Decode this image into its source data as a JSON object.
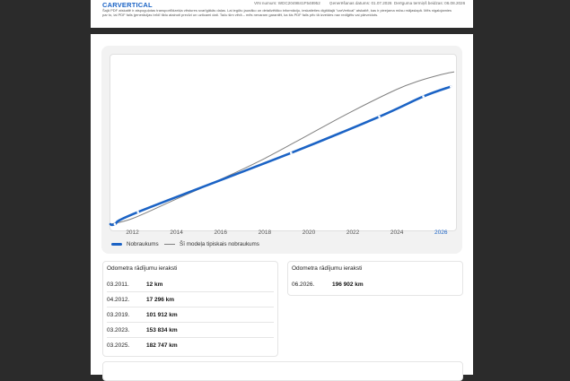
{
  "header": {
    "brand": "CARVERTICAL",
    "vin": "VIN numurs: WDC2049841F548952",
    "generated": "Ģenerēšanas datums: 01.07.2026",
    "expiry": "Derīguma termiņš beidzas: 06.08.2026",
    "disclaimer": "Šajā PDF atskaitē ir atspoguļotas transportlīdzekļa vēstures svarīgākās daļas. Lai iegūtu jaunāko un detalizētāko informāciju, ieskatieties digitālajā \"carVertical\" atskaitē, kas ir pieejama mūsu mājaslapā. Mēs nigalojamies par to, lai PDF fails ģenerācijas brīdī tiktu atainoti precīzi un uzticami dati. Taču šim vērā – mēs nevaram garantēt, ka šis PDF fails pēc tā izveides nav rediģēts vai pārveidots."
  },
  "chart_data": {
    "type": "line",
    "x_ticks": [
      "2012",
      "2014",
      "2016",
      "2018",
      "2020",
      "2022",
      "2024",
      "2026"
    ],
    "highlight_tick": "2026",
    "xlim": [
      2011.0,
      2026.6
    ],
    "ylim": [
      0,
      240000
    ],
    "grid": false,
    "legend_position": "bottom-left",
    "series": [
      {
        "name": "Nobraukums",
        "color": "#1b63c5",
        "x": [
          2011.0,
          2011.2,
          2012.25,
          2019.2,
          2023.2,
          2025.2,
          2026.45
        ],
        "y": [
          0,
          12,
          17296,
          101912,
          153834,
          182747,
          196902
        ],
        "markers": [
          2011.2,
          2012.25,
          2019.2,
          2023.2,
          2025.2,
          2026.45
        ]
      },
      {
        "name": "Šī modeļa tipiskais nobraukums",
        "color": "#808080",
        "x": [
          2011.0,
          2012,
          2014,
          2016,
          2018,
          2020,
          2022,
          2024,
          2025,
          2026,
          2026.6
        ],
        "y": [
          0,
          8000,
          36000,
          64000,
          94000,
          128000,
          162000,
          193000,
          205000,
          214000,
          218000
        ]
      }
    ]
  },
  "odometer_left": {
    "title": "Odometra rādījumu ieraksti",
    "rows": [
      {
        "date": "03.2011.",
        "value": "12 km"
      },
      {
        "date": "04.2012.",
        "value": "17 296 km"
      },
      {
        "date": "03.2019.",
        "value": "101 912 km"
      },
      {
        "date": "03.2023.",
        "value": "153 834 km"
      },
      {
        "date": "03.2025.",
        "value": "182 747 km"
      }
    ]
  },
  "odometer_right": {
    "title": "Odometra rādījumu ieraksti",
    "rows": [
      {
        "date": "06.2026.",
        "value": "196 902 km"
      }
    ]
  }
}
